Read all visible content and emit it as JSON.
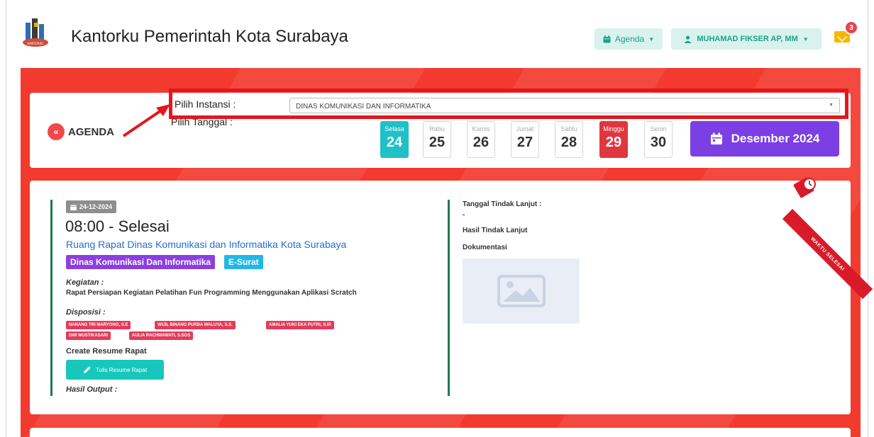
{
  "header": {
    "title": "Kantorku Pemerintah Kota Surabaya",
    "agenda_menu": "Agenda",
    "user_name": "MUHAMAD FIKSER AP, MM",
    "mail_count": "3"
  },
  "filter": {
    "back_label": "AGENDA",
    "instansi_label": "Pilih Instansi :",
    "tanggal_label": "Pilih Tanggal :",
    "instansi_value": "DINAS KOMUNIKASI DAN INFORMATIKA",
    "days": [
      {
        "name": "Selasa",
        "num": "24",
        "state": "selected"
      },
      {
        "name": "Rabu",
        "num": "25",
        "state": "normal"
      },
      {
        "name": "Kamis",
        "num": "26",
        "state": "normal"
      },
      {
        "name": "Jumat",
        "num": "27",
        "state": "normal"
      },
      {
        "name": "Sabtu",
        "num": "28",
        "state": "normal"
      },
      {
        "name": "Minggu",
        "num": "29",
        "state": "sunday"
      },
      {
        "name": "Senin",
        "num": "30",
        "state": "normal"
      }
    ],
    "month_label": "Desember 2024"
  },
  "agenda_item": {
    "date": "24-12-2024",
    "time": "08:00 - Selesai",
    "room": "Ruang Rapat Dinas Komunikasi dan Informatika Kota Surabaya",
    "tag_unit": "Dinas Komunikasi Dan Informatika",
    "tag_source": "E-Surat",
    "kegiatan_label": "Kegiatan :",
    "kegiatan_value": "Rapat Persiapan Kegiatan Pelatihan Fun Programming Menggunakan Aplikasi Scratch",
    "disposisi_label": "Disposisi :",
    "disposisi": [
      "NANANG TRI MARYONO, S.E",
      "WIJIL BINANG PURBA WALUYA, S.S.",
      "AMALIA YUKI EKA PUTRI, S.IP.",
      "DWI MUSTIKASARI",
      "AULIA RACHMAWATI, S.SOS"
    ],
    "resume_label": "Create Resume Rapat",
    "resume_button": "Tulis Resume Rapat",
    "output_label": "Hasil Output :",
    "followup_date_label": "Tanggal Tindak Lanjut :",
    "followup_date_value": "-",
    "followup_result_label": "Hasil Tindak Lanjut",
    "documentation_label": "Dokumentasi",
    "ribbon_text": "WAKTU SELESAI"
  },
  "colors": {
    "accent_red": "#f23a2f",
    "highlight_border": "#e5161d",
    "teal": "#1fc0c8",
    "purple": "#7b3fe4"
  }
}
